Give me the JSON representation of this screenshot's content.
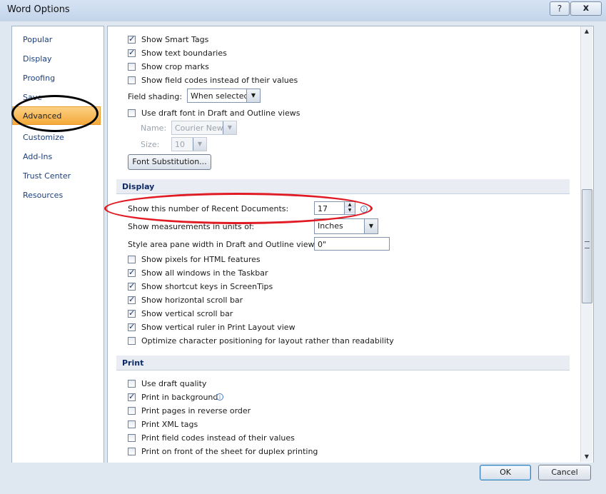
{
  "window": {
    "title": "Word Options",
    "help_glyph": "?",
    "close_glyph": "x"
  },
  "nav": [
    {
      "label": "Popular"
    },
    {
      "label": "Display"
    },
    {
      "label": "Proofing"
    },
    {
      "label": "Save"
    },
    {
      "label": "Advanced"
    },
    {
      "label": "Customize"
    },
    {
      "label": "Add-Ins"
    },
    {
      "label": "Trust Center"
    },
    {
      "label": "Resources"
    }
  ],
  "show_doc": {
    "smart_tags": "Show Smart Tags",
    "text_boundaries": "Show text boundaries",
    "crop_marks": "Show crop marks",
    "field_codes": "Show field codes instead of their values",
    "field_shading_label": "Field shading:",
    "field_shading_value": "When selected",
    "draft_font": "Use draft font in Draft and Outline views",
    "name_label": "Name:",
    "name_value": "Courier New",
    "size_label": "Size:",
    "size_value": "10",
    "font_subst": "Font Substitution..."
  },
  "display": {
    "header": "Display",
    "recent_docs_label": "Show this number of Recent Documents:",
    "recent_docs_value": "17",
    "measure_label": "Show measurements in units of:",
    "measure_value": "Inches",
    "style_area_label": "Style area pane width in Draft and Outline views:",
    "style_area_value": "0\"",
    "pixels_html": "Show pixels for HTML features",
    "all_windows": "Show all windows in the Taskbar",
    "shortcut_keys": "Show shortcut keys in ScreenTips",
    "hscroll": "Show horizontal scroll bar",
    "vscroll": "Show vertical scroll bar",
    "vruler": "Show vertical ruler in Print Layout view",
    "optimize": "Optimize character positioning for layout rather than readability"
  },
  "print": {
    "header": "Print",
    "draft_quality": "Use draft quality",
    "background": "Print in background",
    "reverse": "Print pages in reverse order",
    "xml_tags": "Print XML tags",
    "field_codes": "Print field codes instead of their values",
    "duplex": "Print on front of the sheet for duplex printing"
  },
  "buttons": {
    "ok": "OK",
    "cancel": "Cancel"
  },
  "info_glyph": "i"
}
